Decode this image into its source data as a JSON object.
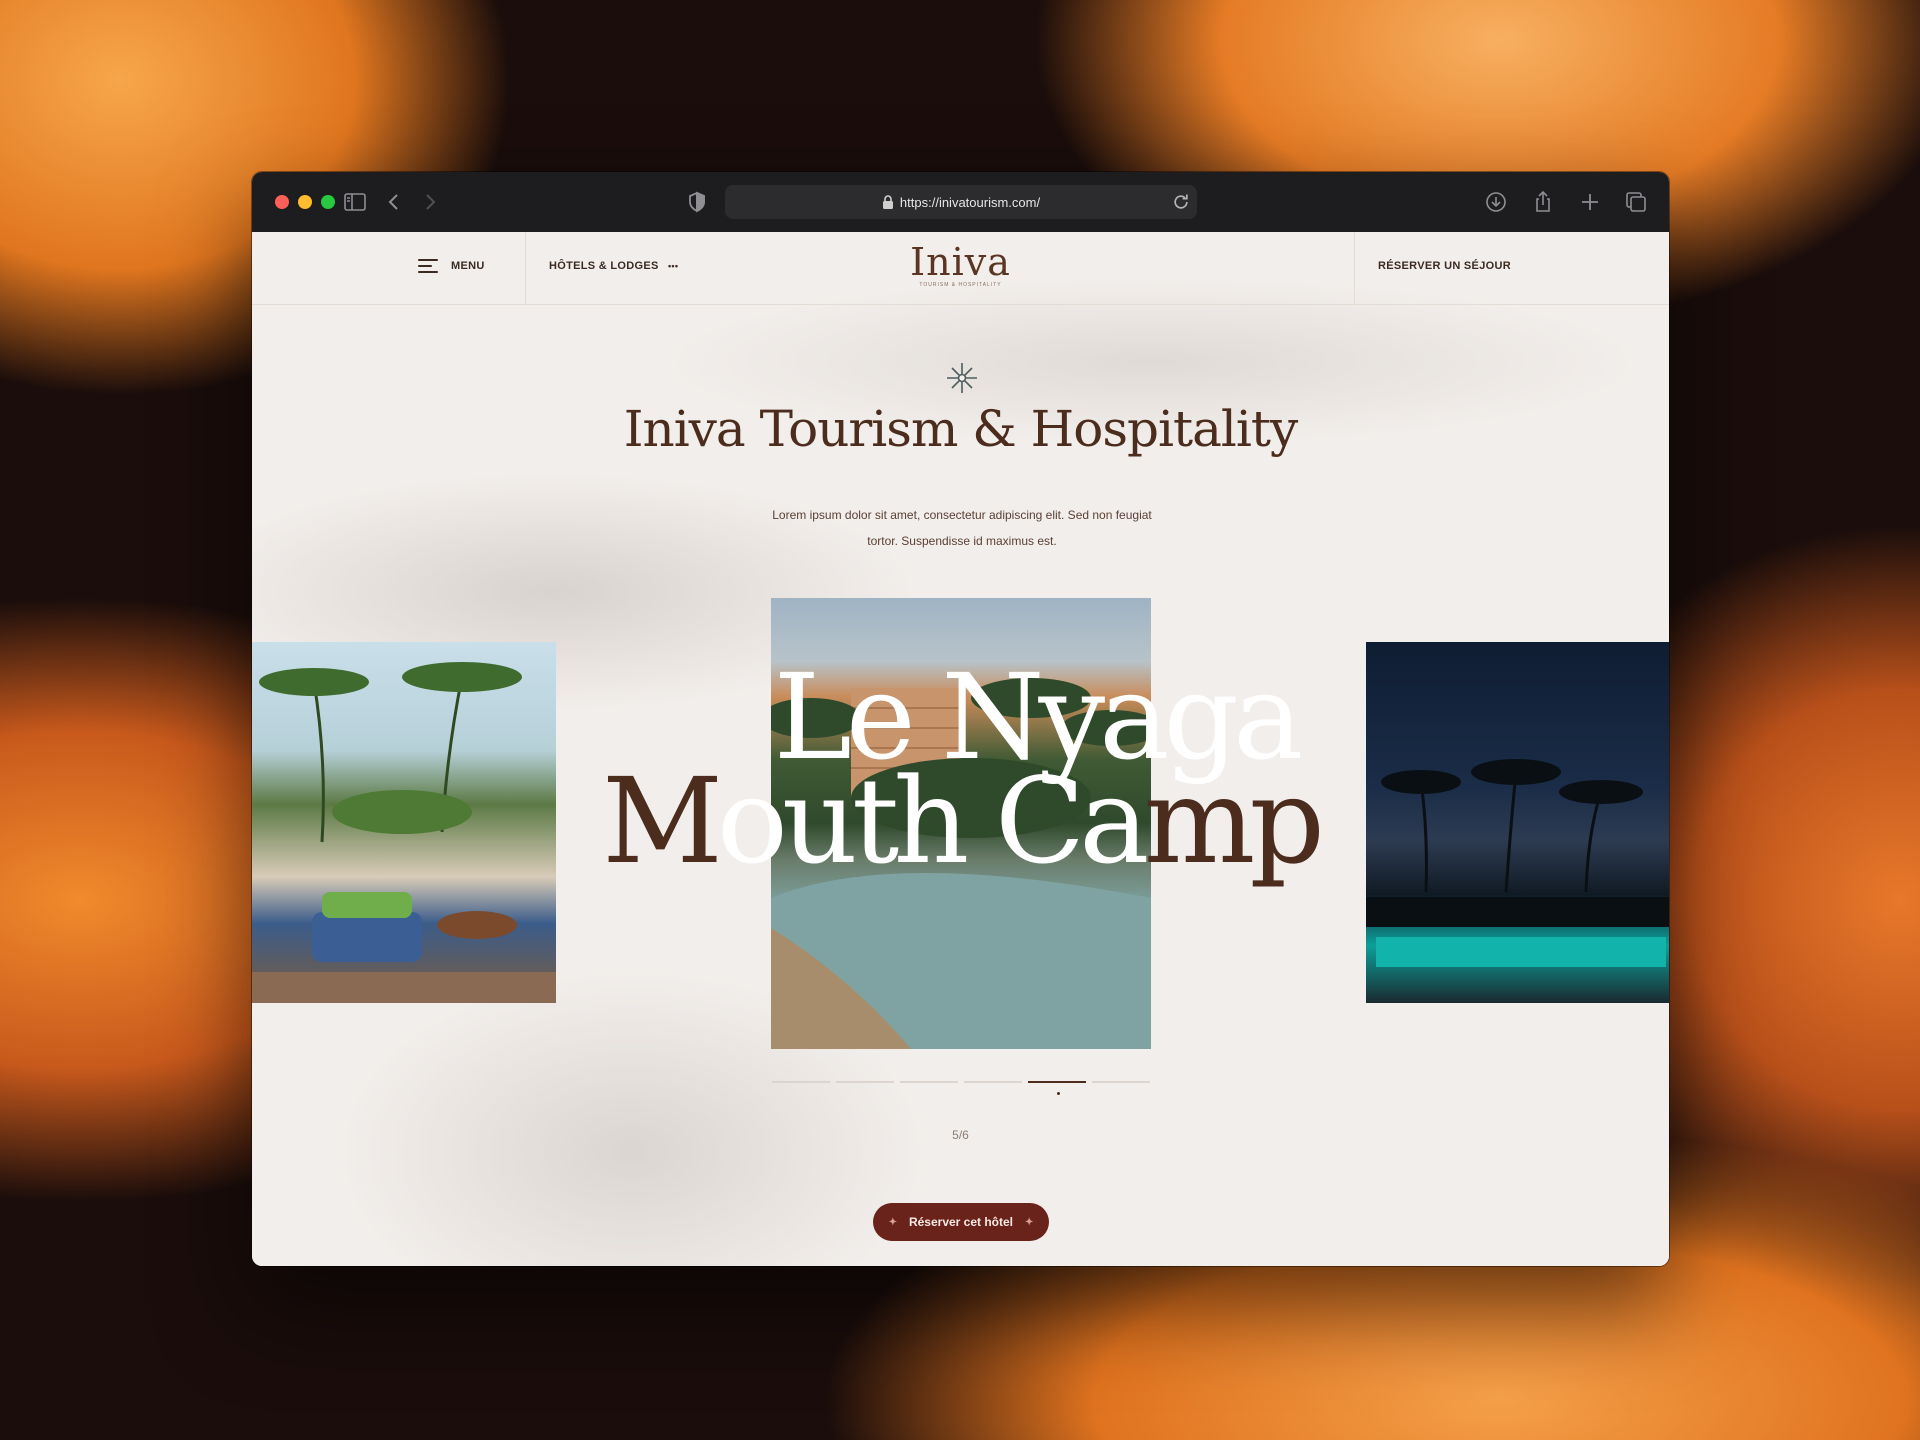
{
  "browser": {
    "url": "https://inivatourism.com/"
  },
  "nav": {
    "menu_label": "MENU",
    "hotels_label": "HÔTELS & LODGES",
    "hotels_dots": "•••",
    "logo_text": "Iniva",
    "logo_subtitle": "TOURISM & HOSPITALITY",
    "reserve_label": "RÉSERVER UN SÉJOUR"
  },
  "intro": {
    "title": "Iniva Tourism & Hospitality",
    "description_line1": "Lorem ipsum dolor sit amet, consectetur adipiscing elit. Sed non feugiat",
    "description_line2": "tortor. Suspendisse id maximus est."
  },
  "slider": {
    "hotel_name_line1": "Le Nyaga",
    "hotel_name_line2_part1": "M",
    "hotel_name_line2_part2": "outh Ca",
    "hotel_name_line2_part3": "mp",
    "current": 5,
    "total": 6,
    "counter": "5/6"
  },
  "cta": {
    "label": "Réserver cet hôtel"
  },
  "colors": {
    "brand_brown": "#4b2c1d",
    "cta_red": "#6a231b",
    "page_bg": "#f2eeeb"
  }
}
